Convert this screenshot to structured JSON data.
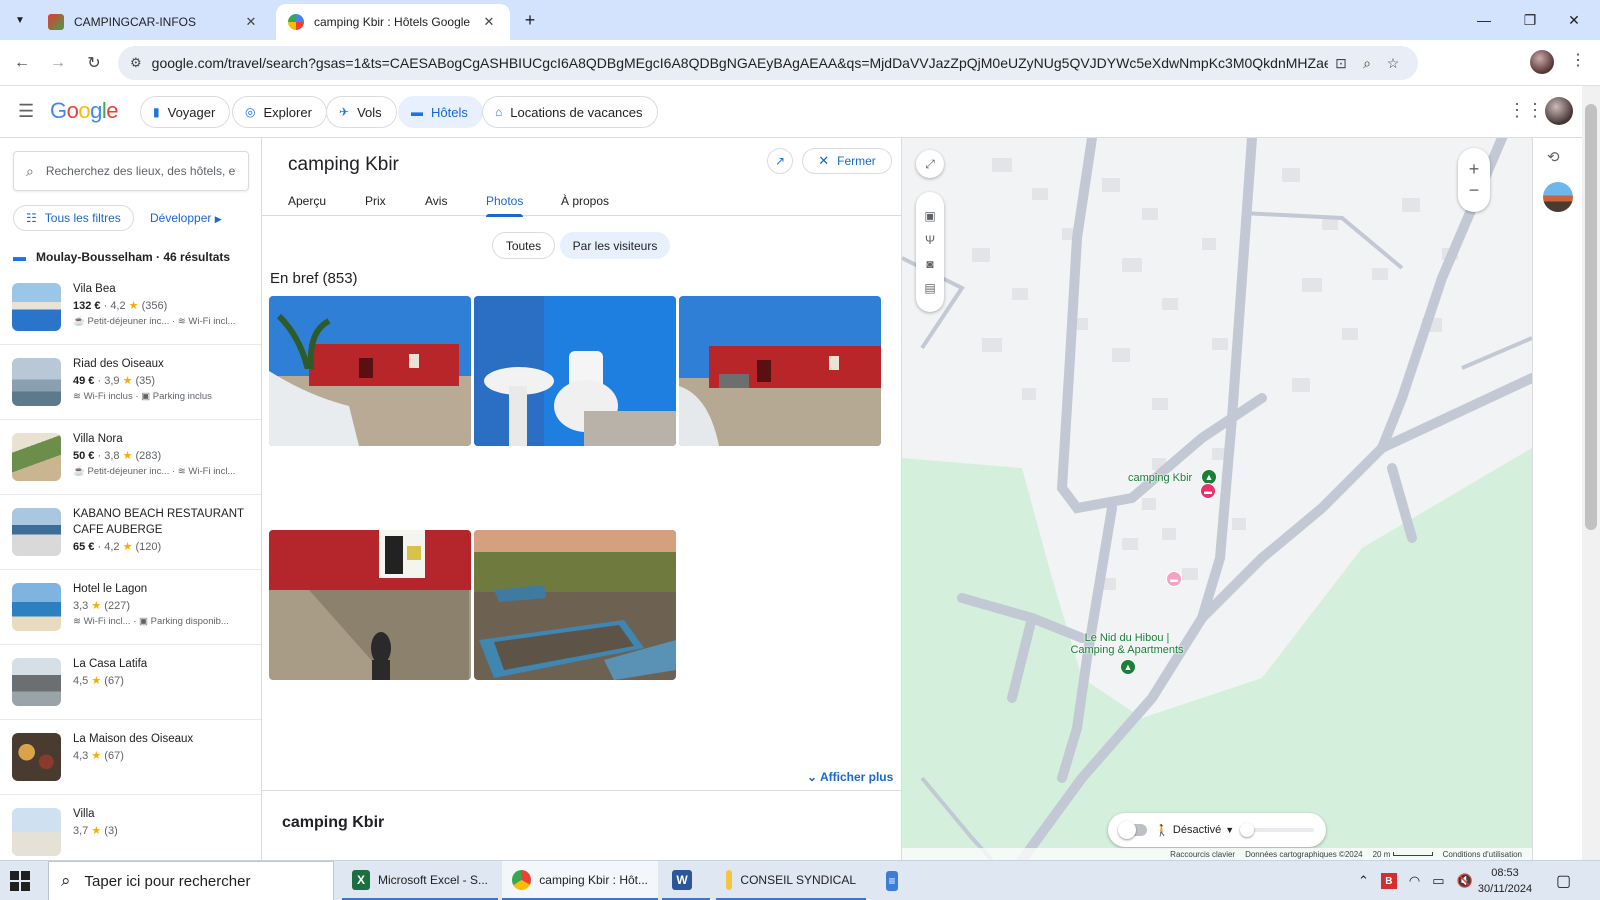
{
  "browser": {
    "tabs": [
      {
        "title": "CAMPINGCAR-INFOS",
        "active": false
      },
      {
        "title": "camping Kbir : Hôtels Google",
        "active": true
      }
    ],
    "url": "google.com/travel/search?gsas=1&ts=CAESABogCgASHBIUCgcI6A8QDBgMEgcI6A8QDBgNGAEyBAgAEAA&qs=MjdDaVVJazZpQjM0eUZyNUg5QVJDYWc5eXdwNmpKc3M0QkdnMHZaeTh4TVhSNE4zZ..."
  },
  "header": {
    "logo": "Google",
    "nav": [
      {
        "label": "Voyager",
        "icon": "luggage-icon",
        "active": false
      },
      {
        "label": "Explorer",
        "icon": "explore-icon",
        "active": false
      },
      {
        "label": "Vols",
        "icon": "flight-icon",
        "active": false
      },
      {
        "label": "Hôtels",
        "icon": "hotel-icon",
        "active": true
      },
      {
        "label": "Locations de vacances",
        "icon": "house-icon",
        "active": false
      }
    ]
  },
  "sidebar": {
    "search_placeholder": "Recherchez des lieux, des hôtels, et...",
    "filters_label": "Tous les filtres",
    "develop_label": "Développer",
    "results_label": "Moulay-Bousselham · 46 résultats",
    "hotels": [
      {
        "name": "Vila Bea",
        "price": "132 €",
        "rating": "4,2",
        "reviews": "(356)",
        "amenities": [
          "Petit-déjeuner inc...",
          "Wi-Fi incl..."
        ]
      },
      {
        "name": "Riad des Oiseaux",
        "price": "49 €",
        "rating": "3,9",
        "reviews": "(35)",
        "amenities": [
          "Wi-Fi inclus",
          "Parking inclus"
        ]
      },
      {
        "name": "Villa Nora",
        "price": "50 €",
        "rating": "3,8",
        "reviews": "(283)",
        "amenities": [
          "Petit-déjeuner inc...",
          "Wi-Fi incl..."
        ]
      },
      {
        "name": "KABANO BEACH RESTAURANT CAFE AUBERGE",
        "price": "65 €",
        "rating": "4,2",
        "reviews": "(120)",
        "amenities": []
      },
      {
        "name": "Hotel le Lagon",
        "price": "",
        "rating": "3,3",
        "reviews": "(227)",
        "amenities": [
          "Wi-Fi incl...",
          "Parking disponib..."
        ]
      },
      {
        "name": "La Casa Latifa",
        "price": "",
        "rating": "4,5",
        "reviews": "(67)",
        "amenities": []
      },
      {
        "name": "La Maison des Oiseaux",
        "price": "",
        "rating": "4,3",
        "reviews": "(67)",
        "amenities": []
      },
      {
        "name": "Villa",
        "price": "",
        "rating": "3,7",
        "reviews": "(3)",
        "amenities": []
      }
    ]
  },
  "detail": {
    "title": "camping Kbir",
    "close_label": "Fermer",
    "tabs": [
      "Aperçu",
      "Prix",
      "Avis",
      "Photos",
      "À propos"
    ],
    "active_tab": "Photos",
    "segments": [
      "Toutes",
      "Par les visiteurs"
    ],
    "active_segment": "Par les visiteurs",
    "section_title": "En bref (853)",
    "show_more": "Afficher plus",
    "bottom_title": "camping Kbir"
  },
  "map": {
    "labels": {
      "camping": "camping Kbir",
      "nid_line1": "Le Nid du Hibou |",
      "nid_line2": "Camping & Apartments"
    },
    "toggle_label": "Désactivé",
    "attribution": [
      "Raccourcis clavier",
      "Données cartographiques ©2024",
      "20 m",
      "Conditions d'utilisation"
    ],
    "colors": {
      "green_area": "#d4f0dc",
      "road": "#c3c9d4",
      "building": "#e2e4e8"
    }
  },
  "taskbar": {
    "search_placeholder": "Taper ici pour rechercher",
    "apps": [
      "Microsoft Excel - S...",
      "camping Kbir : Hôt...",
      "",
      "CONSEIL SYNDICAL"
    ],
    "time": "08:53",
    "date": "30/11/2024"
  }
}
